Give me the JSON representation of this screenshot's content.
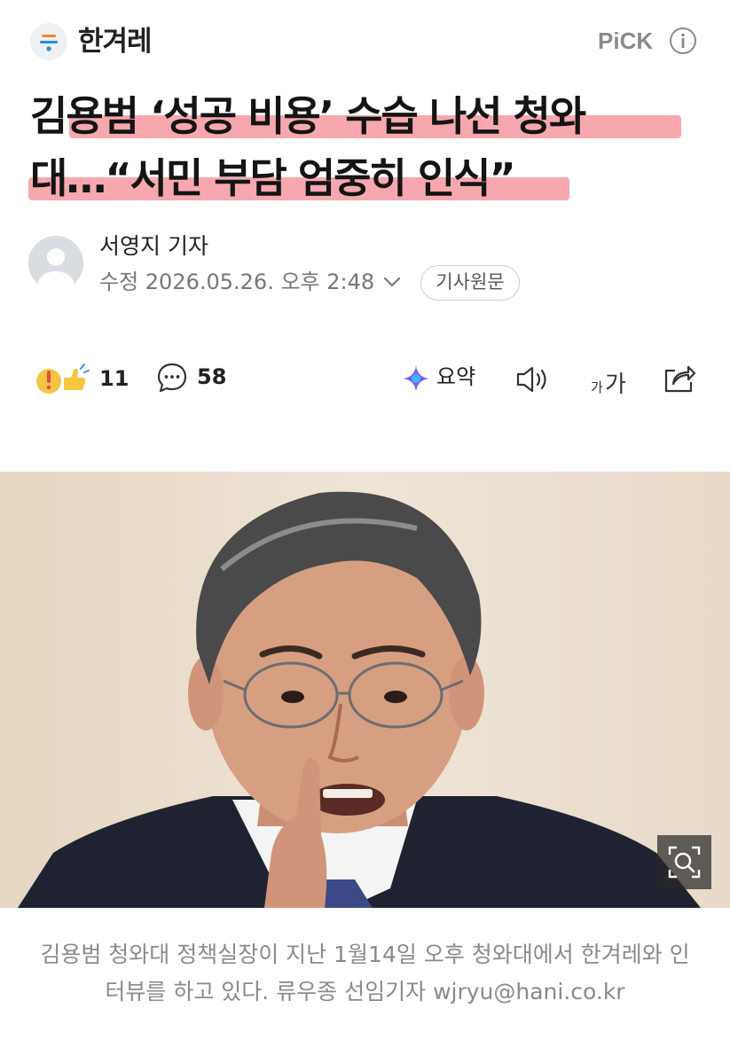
{
  "header": {
    "press_name": "한겨레",
    "pick_label": "PiCK"
  },
  "article": {
    "headline_line1": "김용범 ‘성공 비용’ 수습 나선 청와",
    "headline_line2": "대…“서민 부담 엄중히 인식”",
    "reporter": "서영지 기자",
    "edited_label": "수정 2026.05.26. 오후 2:48",
    "original_button": "기사원문",
    "highlight_color": "#f0606e"
  },
  "actions": {
    "reaction_count": "11",
    "comment_count": "58",
    "summary_label": "요약",
    "icons": [
      "reaction-icon",
      "comment-icon",
      "summary-icon",
      "speaker-icon",
      "font-size-icon",
      "share-icon"
    ]
  },
  "photo": {
    "zoom_icon": "zoom-icon",
    "caption": "김용범 청와대 정책실장이 지난 1월14일 오후 청와대에서 한겨레와 인터뷰를 하고 있다. 류우종 선임기자 wjryu@hani.co.kr"
  }
}
